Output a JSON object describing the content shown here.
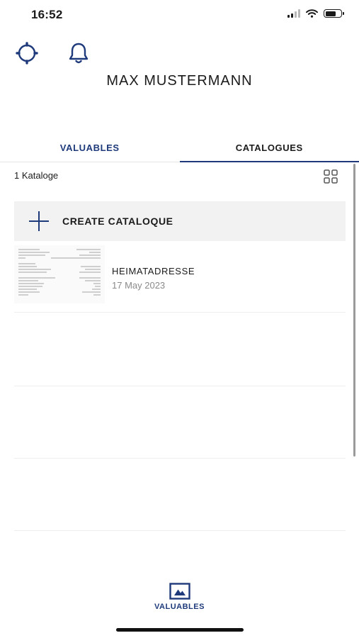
{
  "status_bar": {
    "time": "16:52"
  },
  "header": {
    "settings_icon": "gear-icon",
    "notifications_icon": "bell-icon",
    "user_name": "MAX MUSTERMANN"
  },
  "tabs": [
    {
      "label": "VALUABLES",
      "active": false
    },
    {
      "label": "CATALOGUES",
      "active": true
    }
  ],
  "catalogues": {
    "count_text": "1 Kataloge",
    "view_toggle_icon": "grid-view-icon",
    "create_label": "CREATE CATALOQUE",
    "items": [
      {
        "name": "HEIMATADRESSE",
        "date": "17 May 2023"
      }
    ]
  },
  "bottom_nav": {
    "label": "VALUABLES",
    "icon": "valuables-icon"
  },
  "colors": {
    "accent": "#1e3a7b",
    "text": "#1b1b1b",
    "muted": "#8a8a8a",
    "panel": "#f2f2f2"
  }
}
